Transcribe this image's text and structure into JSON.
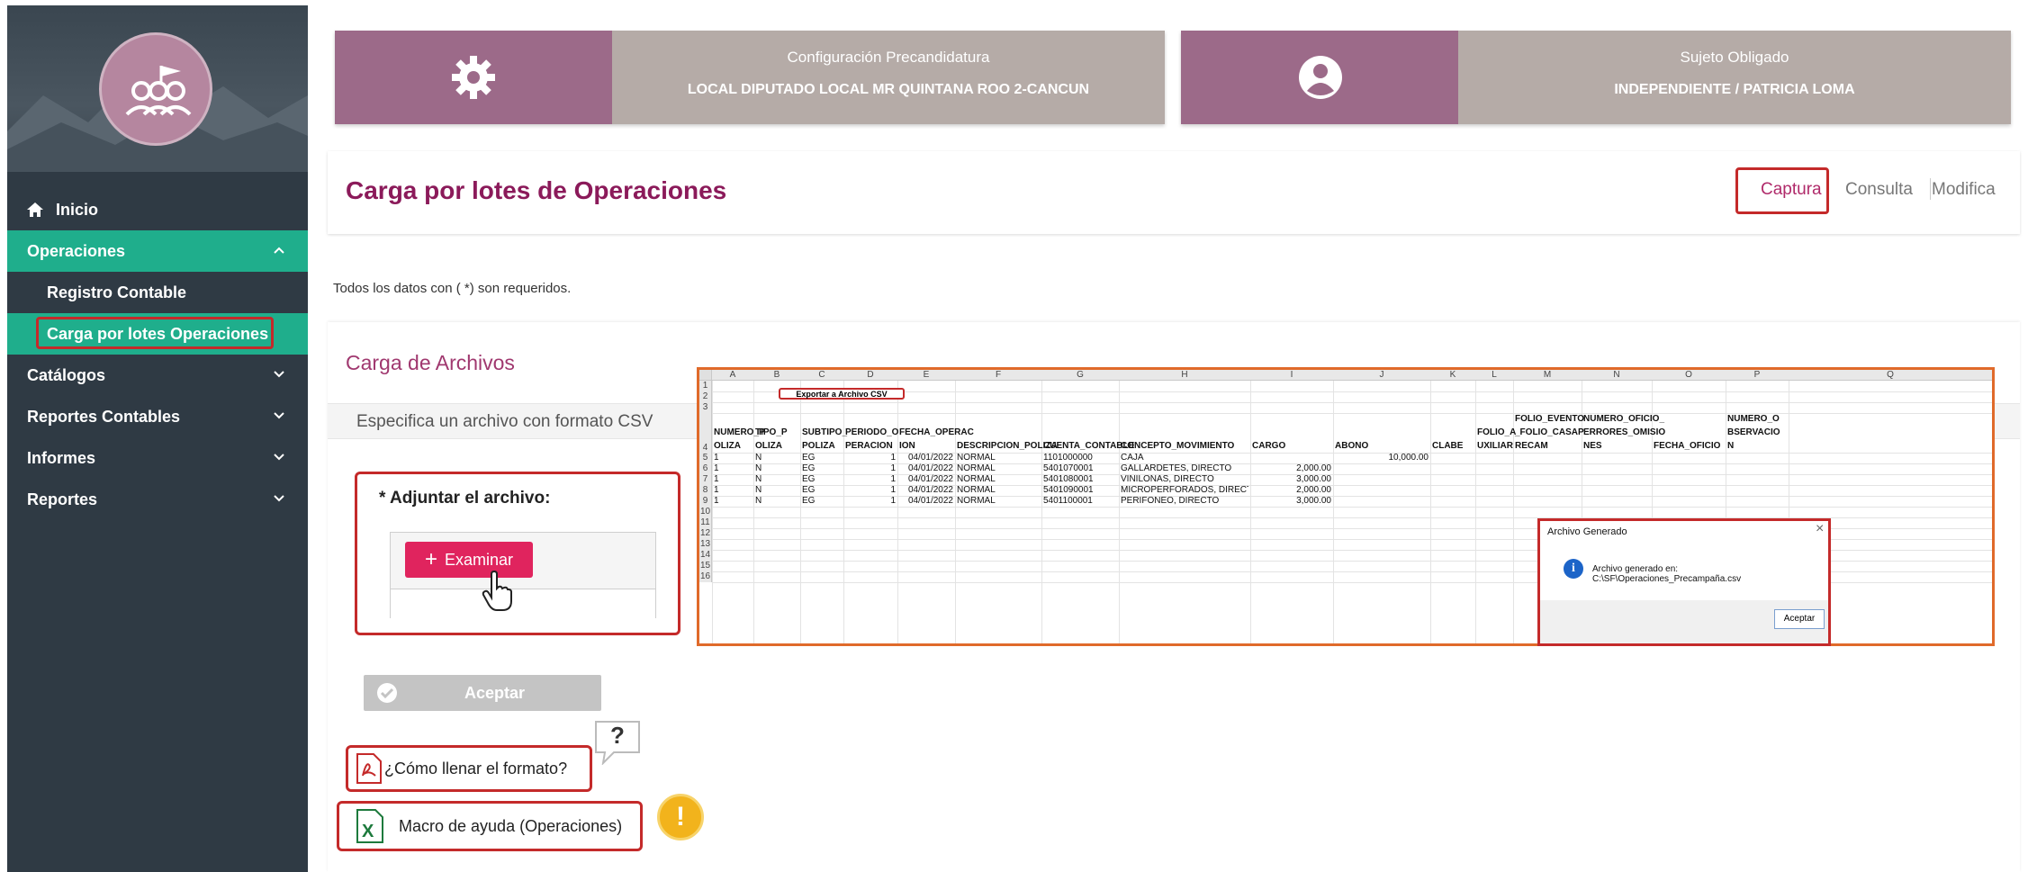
{
  "sidebar": {
    "inicio": "Inicio",
    "operaciones": "Operaciones",
    "registro_contable": "Registro Contable",
    "carga_lotes": "Carga por lotes Operaciones",
    "catalogos": "Catálogos",
    "reportes_contables": "Reportes Contables",
    "informes": "Informes",
    "reportes": "Reportes"
  },
  "cards": {
    "config_title": "Configuración Precandidatura",
    "config_value": "LOCAL DIPUTADO LOCAL MR QUINTANA ROO 2-CANCUN",
    "sujeto_title": "Sujeto Obligado",
    "sujeto_value": "INDEPENDIENTE / PATRICIA LOMA"
  },
  "header": {
    "title": "Carga por lotes de Operaciones",
    "tabs": [
      "Captura",
      "Consulta",
      "Modifica"
    ]
  },
  "required_note": "Todos los datos con ( *) son requeridos.",
  "panel": {
    "title": "Carga de Archivos",
    "subtitle": "Especifica un archivo con formato CSV",
    "attach_label": "* Adjuntar el archivo:",
    "examinar": "Examinar",
    "aceptar": "Aceptar",
    "how_to": "¿Cómo llenar el formato?",
    "macro": "Macro de ayuda (Operaciones)",
    "question_mark": "?",
    "exclamation": "!"
  },
  "excel": {
    "columns": [
      "A",
      "B",
      "C",
      "D",
      "E",
      "F",
      "G",
      "H",
      "I",
      "J",
      "K",
      "L",
      "M",
      "N",
      "O",
      "P",
      "Q"
    ],
    "rows": [
      "1",
      "2",
      "3",
      "4",
      "5",
      "6",
      "7",
      "8",
      "9",
      "10",
      "11",
      "12",
      "13",
      "14",
      "15",
      "16"
    ],
    "export_button": "Exportar a Archivo CSV",
    "headers": [
      [
        "NUMERO_P",
        "OLIZA"
      ],
      [
        "TIPO_P",
        "OLIZA"
      ],
      [
        "SUBTIPO_",
        "POLIZA"
      ],
      [
        "PERIODO_O",
        "PERACION"
      ],
      [
        "FECHA_OPERAC",
        "ION"
      ],
      [
        "DESCRIPCION_POLIZA"
      ],
      [
        "CUENTA_CONTABLE"
      ],
      [
        "CONCEPTO_MOVIMIENTO"
      ],
      [
        "CARGO"
      ],
      [
        "ABONO"
      ],
      [
        "CLABE"
      ],
      [
        "FOLIO_A",
        "UXILIAR"
      ],
      [
        "FOLIO_EVENTO",
        "_FOLIO_CASAP",
        "RECAM"
      ],
      [
        "NUMERO_OFICIO_",
        "ERRORES_OMISIO",
        "NES"
      ],
      [
        "FECHA_OFICIO"
      ],
      [
        "NUMERO_O",
        "BSERVACIO",
        "N"
      ]
    ],
    "data": [
      [
        "1",
        "N",
        "EG",
        "1",
        "04/01/2022",
        "NORMAL",
        "1101000000",
        "CAJA",
        "",
        "10,000.00"
      ],
      [
        "1",
        "N",
        "EG",
        "1",
        "04/01/2022",
        "NORMAL",
        "5401070001",
        "GALLARDETES, DIRECTO",
        "2,000.00",
        ""
      ],
      [
        "1",
        "N",
        "EG",
        "1",
        "04/01/2022",
        "NORMAL",
        "5401080001",
        "VINILONAS, DIRECTO",
        "3,000.00",
        ""
      ],
      [
        "1",
        "N",
        "EG",
        "1",
        "04/01/2022",
        "NORMAL",
        "5401090001",
        "MICROPERFORADOS, DIRECTO",
        "2,000.00",
        ""
      ],
      [
        "1",
        "N",
        "EG",
        "1",
        "04/01/2022",
        "NORMAL",
        "5401100001",
        "PERIFONEO, DIRECTO",
        "3,000.00",
        ""
      ]
    ],
    "dialog_title": "Archivo Generado",
    "dialog_message": "Archivo generado en: C:\\SF\\Operaciones_Precampaña.csv",
    "dialog_button": "Aceptar",
    "dialog_close": "×",
    "info_glyph": "i"
  }
}
